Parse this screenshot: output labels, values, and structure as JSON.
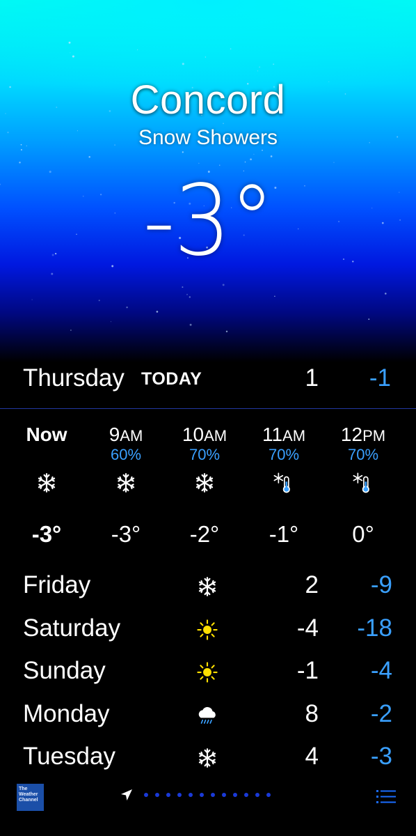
{
  "location": {
    "city": "Concord",
    "condition": "Snow Showers",
    "temperature": "-3°"
  },
  "today": {
    "day": "Thursday",
    "label": "TODAY",
    "high": "1",
    "low": "-1"
  },
  "hourly": [
    {
      "time": "Now",
      "ampm": "",
      "pop": "",
      "icon": "snowflake-icon",
      "temp": "-3°",
      "bold": true
    },
    {
      "time": "9",
      "ampm": "AM",
      "pop": "60%",
      "icon": "snowflake-icon",
      "temp": "-3°"
    },
    {
      "time": "10",
      "ampm": "AM",
      "pop": "70%",
      "icon": "snowflake-icon",
      "temp": "-2°"
    },
    {
      "time": "11",
      "ampm": "AM",
      "pop": "70%",
      "icon": "snow-thermometer-icon",
      "temp": "-1°"
    },
    {
      "time": "12",
      "ampm": "PM",
      "pop": "70%",
      "icon": "snow-thermometer-icon",
      "temp": "0°"
    }
  ],
  "daily": [
    {
      "day": "Friday",
      "icon": "snowflake-icon",
      "high": "2",
      "low": "-9"
    },
    {
      "day": "Saturday",
      "icon": "sun-icon",
      "high": "-4",
      "low": "-18"
    },
    {
      "day": "Sunday",
      "icon": "sun-icon",
      "high": "-1",
      "low": "-4"
    },
    {
      "day": "Monday",
      "icon": "rain-cloud-icon",
      "high": "8",
      "low": "-2"
    },
    {
      "day": "Tuesday",
      "icon": "snowflake-icon",
      "high": "4",
      "low": "-3"
    }
  ],
  "footer": {
    "logo_text": [
      "The",
      "Weather",
      "Channel"
    ],
    "page_dot_count": 12
  },
  "colors": {
    "accent_blue": "#3aa0ff",
    "sun_yellow": "#ffe000",
    "dot_blue": "#1a3ad8"
  }
}
